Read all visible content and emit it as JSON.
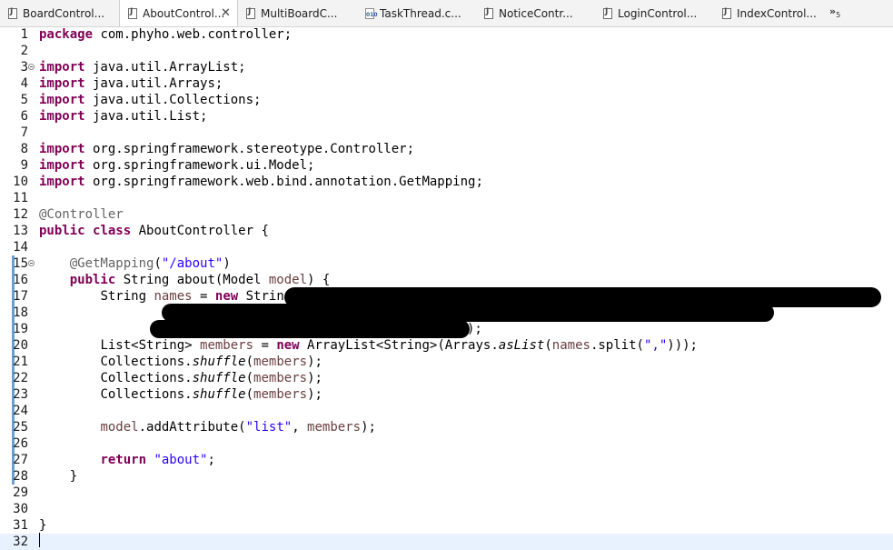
{
  "tabs": [
    {
      "label": "BoardControl...",
      "icon": "java-file-icon",
      "active": false
    },
    {
      "label": "AboutControl...",
      "icon": "java-file-icon",
      "active": true
    },
    {
      "label": "MultiBoardC...",
      "icon": "java-file-icon",
      "active": false
    },
    {
      "label": "TaskThread.c...",
      "icon": "class-file-icon",
      "active": false
    },
    {
      "label": "NoticeContr...",
      "icon": "java-file-icon",
      "active": false
    },
    {
      "label": "LoginControl...",
      "icon": "java-file-icon",
      "active": false
    },
    {
      "label": "IndexControl...",
      "icon": "java-file-icon",
      "active": false
    }
  ],
  "tab_close": "✕",
  "overflow": {
    "glyph": "»",
    "count": "5"
  },
  "lines": [
    {
      "n": "1"
    },
    {
      "n": "2"
    },
    {
      "n": "3"
    },
    {
      "n": "4"
    },
    {
      "n": "5"
    },
    {
      "n": "6"
    },
    {
      "n": "7"
    },
    {
      "n": "8"
    },
    {
      "n": "9"
    },
    {
      "n": "10"
    },
    {
      "n": "11"
    },
    {
      "n": "12"
    },
    {
      "n": "13"
    },
    {
      "n": "14"
    },
    {
      "n": "15"
    },
    {
      "n": "16"
    },
    {
      "n": "17"
    },
    {
      "n": "18"
    },
    {
      "n": "19"
    },
    {
      "n": "20"
    },
    {
      "n": "21"
    },
    {
      "n": "22"
    },
    {
      "n": "23"
    },
    {
      "n": "24"
    },
    {
      "n": "25"
    },
    {
      "n": "26"
    },
    {
      "n": "27"
    },
    {
      "n": "28"
    },
    {
      "n": "29"
    },
    {
      "n": "30"
    },
    {
      "n": "31"
    },
    {
      "n": "32"
    }
  ],
  "code": {
    "l1_kw": "package",
    "l1_rest": " com.phyho.web.controller;",
    "import_kw": "import",
    "l3": " java.util.ArrayList;",
    "l4": " java.util.Arrays;",
    "l5": " java.util.Collections;",
    "l6": " java.util.List;",
    "l8": " org.springframework.stereotype.Controller;",
    "l9": " org.springframework.ui.Model;",
    "l10": " org.springframework.web.bind.annotation.GetMapping;",
    "l12": "@Controller",
    "l13_kw1": "public",
    "l13_kw2": "class",
    "l13_rest": " AboutController {",
    "l15_an": "@GetMapping",
    "l15_p1": "(",
    "l15_str": "\"/about\"",
    "l15_p2": ")",
    "l16_kw": "public",
    "l16_rest": " String about(Model ",
    "l16_param": "model",
    "l16_end": ") {",
    "l17_a": "String ",
    "l17_var": "names",
    "l17_b": " = ",
    "l17_kw": "new",
    "l17_c": " String(",
    "l19_end": ");",
    "l20_a": "List<String> ",
    "l20_var": "members",
    "l20_b": " = ",
    "l20_kw": "new",
    "l20_c": " ArrayList<String>(Arrays.",
    "l20_it": "asList",
    "l20_d": "(",
    "l20_var2": "names",
    "l20_e": ".split(",
    "l20_str": "\",\"",
    "l20_f": ")));",
    "shuffle_a": "Collections.",
    "shuffle_it": "shuffle",
    "shuffle_b": "(",
    "shuffle_var": "members",
    "shuffle_c": ");",
    "l25_var": "model",
    "l25_a": ".addAttribute(",
    "l25_str": "\"list\"",
    "l25_b": ", ",
    "l25_var2": "members",
    "l25_c": ");",
    "l27_kw": "return",
    "l27_sp": " ",
    "l27_str": "\"about\"",
    "l27_end": ";",
    "l28": "}",
    "l31": "}"
  }
}
